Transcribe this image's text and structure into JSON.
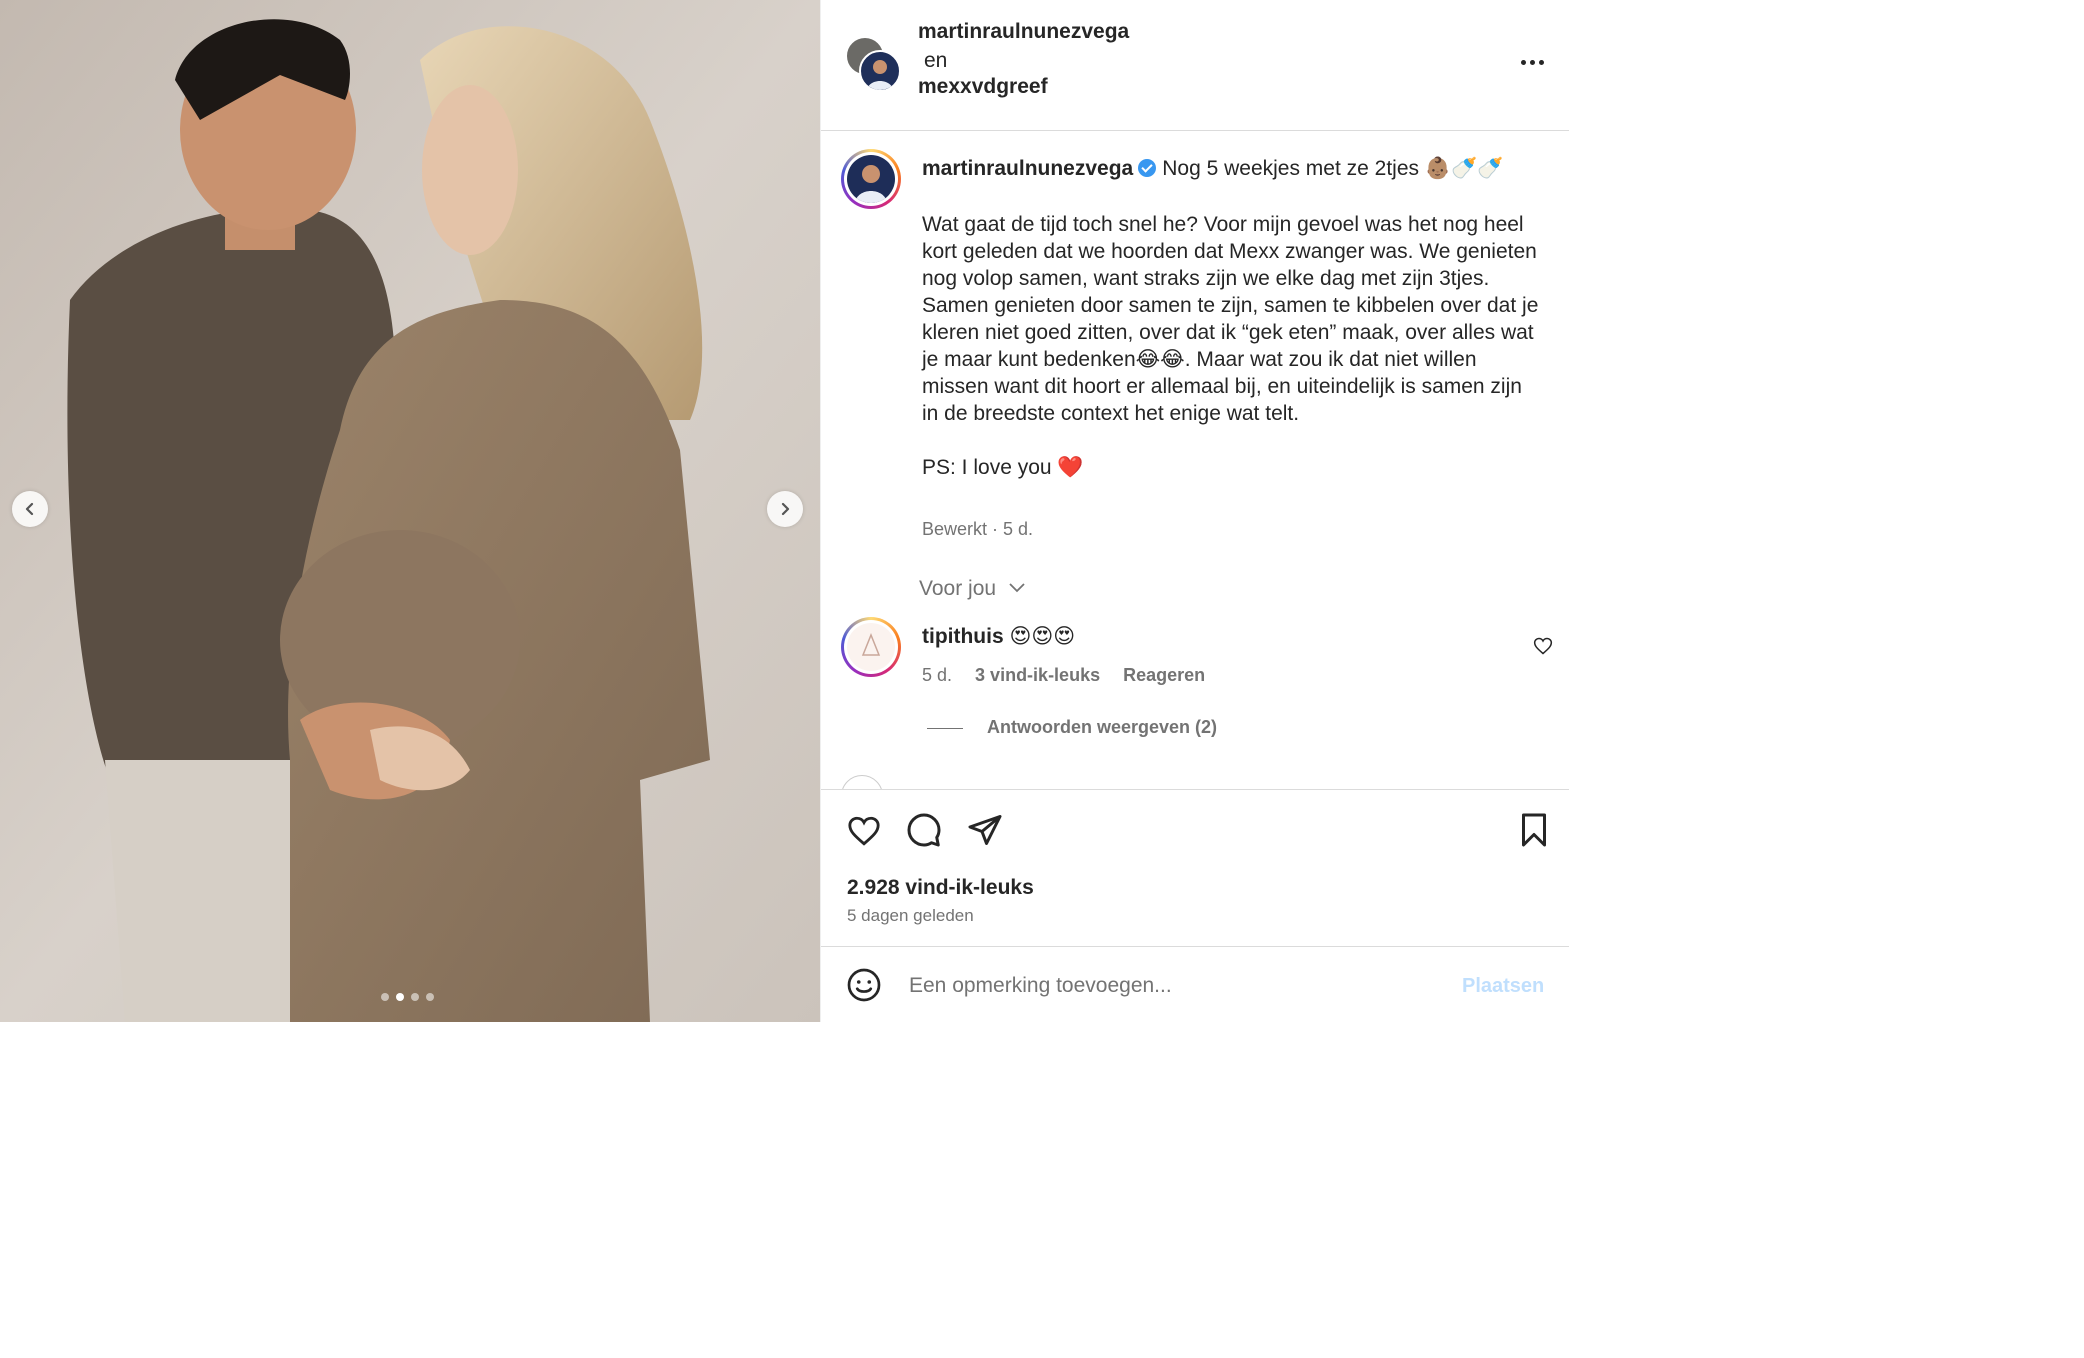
{
  "carousel": {
    "prev_icon": "chevron-left-icon",
    "next_icon": "chevron-right-icon",
    "slide_count": 4,
    "active_slide": 2
  },
  "header": {
    "user1": "martinraulnunezvega",
    "and": "en",
    "user2": "mexxvdgreef",
    "more_icon": "more-horizontal-icon"
  },
  "caption": {
    "username": "martinraulnunezvega",
    "verified_icon": "verified-badge-icon",
    "headline": "Nog 5 weekjes met ze 2tjes 👶🏽🍼🍼",
    "body": "Wat gaat de tijd toch snel he? Voor mijn gevoel was het nog heel kort geleden dat we hoorden dat Mexx zwanger was. We genieten nog volop samen, want straks zijn we elke dag met zijn 3tjes. Samen genieten door samen te zijn, samen te kibbelen over dat je kleren niet goed zitten, over dat ik “gek eten” maak, over alles wat je maar kunt bedenken😂😂. Maar wat zou ik dat niet willen missen want dit hoort er allemaal bij, en uiteindelijk is samen zijn in de breedste context het enige wat telt.",
    "ps": "PS: I love you ❤️",
    "meta": "Bewerkt · 5 d."
  },
  "for_you": "Voor jou",
  "comment": {
    "username": "tipithuis",
    "text": "😍😍😍",
    "age": "5 d.",
    "likes": "3 vind-ik-leuks",
    "reply": "Reageren",
    "view_replies": "Antwoorden weergeven (2)",
    "like_icon": "heart-outline-icon"
  },
  "actions": {
    "like_icon": "heart-outline-icon",
    "comment_icon": "comment-icon",
    "share_icon": "share-icon",
    "save_icon": "bookmark-icon",
    "likes": "2.928 vind-ik-leuks",
    "date": "5 dagen geleden"
  },
  "add_comment": {
    "emoji_icon": "emoji-icon",
    "placeholder": "Een opmerking toevoegen...",
    "post_label": "Plaatsen"
  },
  "colors": {
    "text": "#262626",
    "muted": "#737373",
    "link_disabled": "#c0dffd",
    "verified": "#3897f0",
    "divider": "#dbdbdb"
  }
}
